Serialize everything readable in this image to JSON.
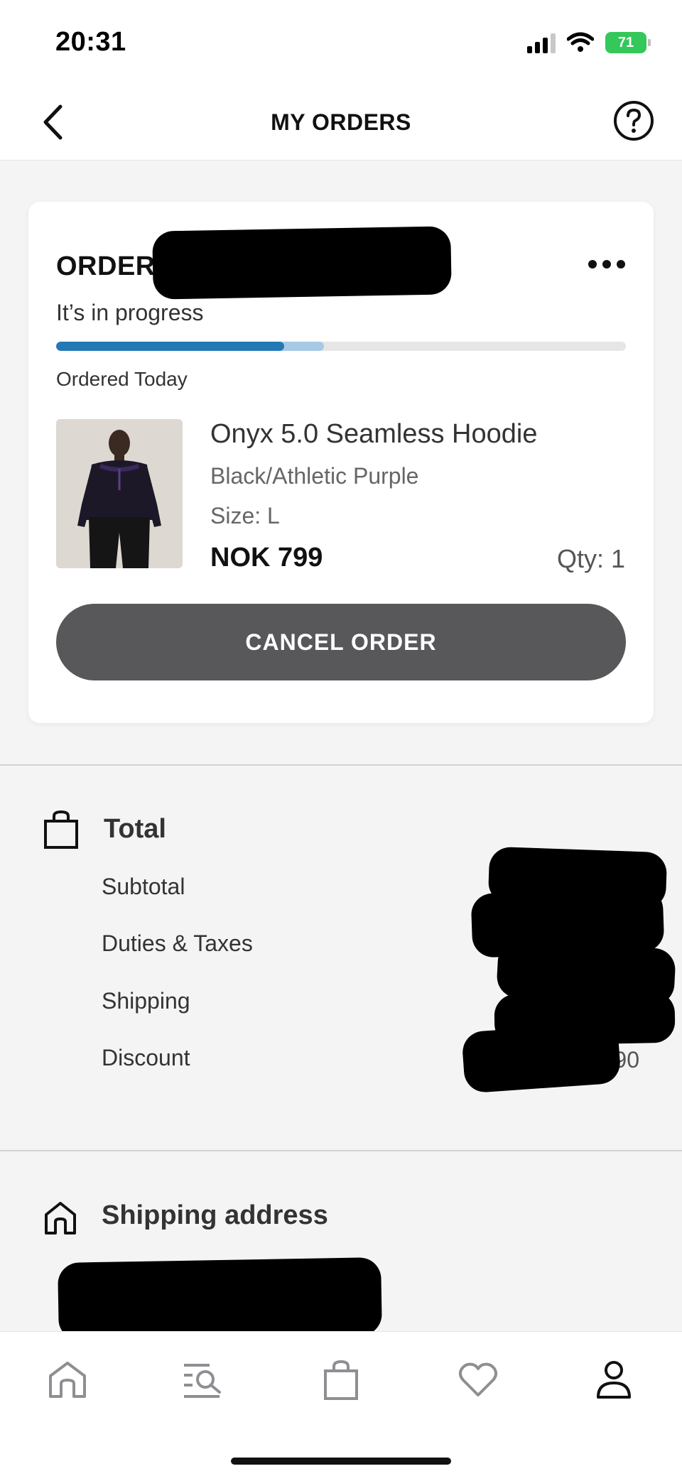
{
  "status_bar": {
    "time": "20:31",
    "battery": "71"
  },
  "header": {
    "title": "MY ORDERS"
  },
  "order": {
    "label": "ORDER",
    "status": "It’s in progress",
    "progress": 0.4,
    "progress_secondary": 0.47,
    "date_text": "Ordered Today",
    "product": {
      "name": "Onyx 5.0 Seamless Hoodie",
      "color": "Black/Athletic Purple",
      "size": "Size: L",
      "price": "NOK 799",
      "qty": "Qty: 1"
    },
    "cancel_label": "CANCEL ORDER"
  },
  "totals": {
    "title": "Total",
    "rows": [
      "Subtotal",
      "Duties & Taxes",
      "Shipping",
      "Discount"
    ],
    "discount_value": "NOK 79.90"
  },
  "shipping": {
    "title": "Shipping address"
  },
  "tab_bar": {
    "items": [
      "home-icon",
      "search-icon",
      "bag-icon",
      "heart-icon",
      "account-icon"
    ],
    "active": "account-icon"
  },
  "colors": {
    "accent": "#2479b5",
    "button": "#58585b",
    "battery": "#34c759",
    "background": "#f4f4f4"
  }
}
